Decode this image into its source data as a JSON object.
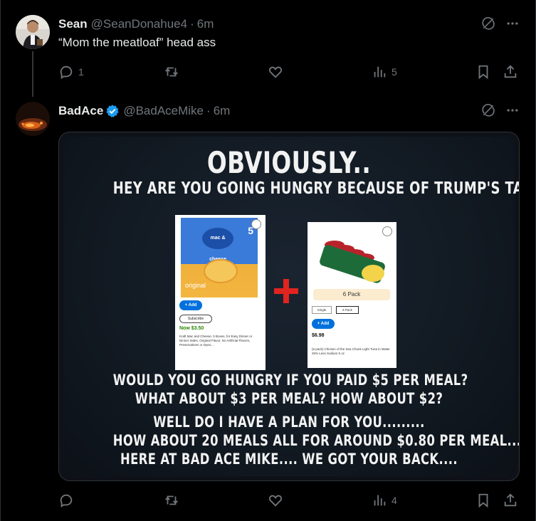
{
  "colors": {
    "background": "#000000",
    "text": "#e7e9ea",
    "muted": "#71767b",
    "verified": "#1d9bf0",
    "plus_sign": "#e0241f"
  },
  "post1": {
    "name": "Sean",
    "handle": "@SeanDonahue4",
    "time": "6m",
    "text": "“Mom the meatloaf” head ass",
    "reply_count": "1",
    "view_count": "5",
    "icons": [
      "grok-icon",
      "more-icon",
      "reply-icon",
      "repost-icon",
      "like-icon",
      "views-icon",
      "bookmark-icon",
      "share-icon"
    ]
  },
  "post2": {
    "name": "BadAce",
    "handle": "@BadAceMike",
    "time": "6m",
    "view_count": "4",
    "meme": {
      "lines": [
        "OBVIOUSLY..",
        "HEY ARE YOU GOING HUNGRY BECAUSE OF TRUMP'S TARIFFS?",
        "WOULD YOU GO HUNGRY IF YOU PAID $5 PER MEAL?",
        "WHAT ABOUT $3 PER MEAL? HOW ABOUT $2?",
        "WELL DO I HAVE A PLAN FOR YOU.........",
        "HOW ABOUT 20 MEALS ALL FOR AROUND $0.80 PER MEAL....",
        "HERE AT BAD ACE MIKE.... WE GOT YOUR BACK...."
      ],
      "product1": {
        "box_brand": "mac & cheese",
        "box_count": "5",
        "box_flavor": "original",
        "add": "+ Add",
        "subscribe": "Subscribe",
        "price": "Now $3.50",
        "desc": "Kraft Mac and Cheese, 5 Boxes, for Easy Dinner or Dinner Sides, Original Flavor, No Artificial Flavors, Preservatives or Dyes,..."
      },
      "product2": {
        "pack": "6 Pack",
        "option1": "Single",
        "option2": "6 Pack",
        "add": "+ Add",
        "price": "$6.98",
        "desc": "(6 pack) Chicken of the Sea Chunk Light Tuna in Water 25% Less Sodium 5 oz"
      }
    }
  }
}
